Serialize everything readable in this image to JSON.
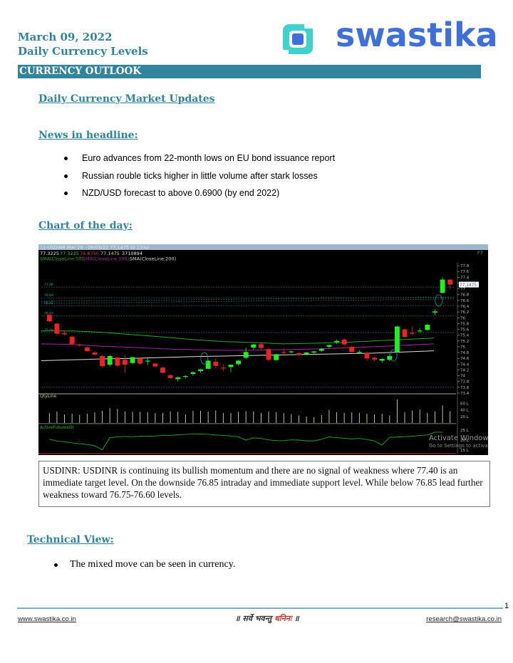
{
  "header": {
    "date": "March 09, 2022",
    "subtitle": "Daily Currency Levels",
    "logo_text": "swastika",
    "section_bar": "CURRENCY OUTLOOK"
  },
  "main": {
    "title": "Daily Currency Market Updates",
    "news_heading": "News in headline:",
    "news": [
      "Euro advances from 22-month lows on EU bond issuance report",
      "Russian rouble ticks higher in little volume after stark losses",
      "NZD/USD forecast to above 0.6900 (by end 2022)"
    ],
    "chart_heading": "Chart of the day:",
    "commentary": "USDINR: USDINR is continuing its bullish momentum and there are no signal of weakness where 77.40 is an immediate target level. On the downside 76.85 intraday and immediate support level. While below 76.85 lead further weakness toward 76.75-76.60 levels.",
    "technical_heading": "Technical View:",
    "technical_points": [
      "The mixed move can be seen in currency."
    ]
  },
  "chart_data": {
    "type": "candlestick",
    "title": "11-USDINR Mar 29 - 08/03/22 77.1475 (0.13%)",
    "ohlc_readout": {
      "open": "77.3225",
      "high": "77.3225",
      "low": "76.8750",
      "close": "77.1475",
      "volume": "3710894"
    },
    "indicator_legend": [
      "SMA(CloseLine:50),",
      "SMA(CloseLine:100),",
      "SMA(CloseLine:200)"
    ],
    "indicator_colors": [
      "#22aa22",
      "#aa22aa",
      "#dddddd"
    ],
    "corner_tag": "F7",
    "last_price_tag": "77.1475",
    "price_axis": {
      "ylim": [
        73.4,
        77.9
      ],
      "ticks": [
        "77.8",
        "77.6",
        "77.4",
        "77.2",
        "77",
        "76.8",
        "76.6",
        "76.4",
        "76.2",
        "76",
        "75.8",
        "75.6",
        "75.4",
        "75.2",
        "75",
        "74.8",
        "74.6",
        "74.4",
        "74.2",
        "74",
        "73.8",
        "73.6",
        "73.4"
      ]
    },
    "level_labels": [
      "77.06",
      "76.69",
      "76.42",
      "76.07",
      "75.49"
    ],
    "candles": [
      {
        "o": 76.1,
        "h": 76.12,
        "l": 75.85,
        "c": 75.88
      },
      {
        "o": 75.8,
        "h": 75.82,
        "l": 75.4,
        "c": 75.45
      },
      {
        "o": 75.47,
        "h": 75.55,
        "l": 75.4,
        "c": 75.43
      },
      {
        "o": 75.35,
        "h": 75.38,
        "l": 75.05,
        "c": 75.1
      },
      {
        "o": 75.08,
        "h": 75.1,
        "l": 75.0,
        "c": 75.05
      },
      {
        "o": 74.98,
        "h": 75.0,
        "l": 74.82,
        "c": 74.85
      },
      {
        "o": 74.8,
        "h": 74.85,
        "l": 74.7,
        "c": 74.73
      },
      {
        "o": 74.68,
        "h": 74.72,
        "l": 74.3,
        "c": 74.33
      },
      {
        "o": 74.38,
        "h": 74.72,
        "l": 74.32,
        "c": 74.68
      },
      {
        "o": 74.63,
        "h": 74.65,
        "l": 74.3,
        "c": 74.35
      },
      {
        "o": 74.55,
        "h": 74.7,
        "l": 74.1,
        "c": 74.38
      },
      {
        "o": 74.44,
        "h": 74.66,
        "l": 74.4,
        "c": 74.64
      },
      {
        "o": 74.6,
        "h": 74.62,
        "l": 74.38,
        "c": 74.42
      },
      {
        "o": 74.52,
        "h": 74.6,
        "l": 74.36,
        "c": 74.52
      },
      {
        "o": 74.42,
        "h": 74.45,
        "l": 74.3,
        "c": 74.32
      },
      {
        "o": 74.28,
        "h": 74.3,
        "l": 74.08,
        "c": 74.1
      },
      {
        "o": 74.02,
        "h": 74.05,
        "l": 73.88,
        "c": 73.92
      },
      {
        "o": 73.88,
        "h": 73.98,
        "l": 73.8,
        "c": 73.94
      },
      {
        "o": 73.96,
        "h": 74.02,
        "l": 73.9,
        "c": 73.99
      },
      {
        "o": 74.06,
        "h": 74.14,
        "l": 74.0,
        "c": 74.12
      },
      {
        "o": 74.16,
        "h": 74.24,
        "l": 74.1,
        "c": 74.22
      },
      {
        "o": 74.24,
        "h": 74.55,
        "l": 74.22,
        "c": 74.52
      },
      {
        "o": 74.48,
        "h": 74.6,
        "l": 74.26,
        "c": 74.34
      },
      {
        "o": 74.28,
        "h": 74.4,
        "l": 74.16,
        "c": 74.26
      },
      {
        "o": 74.3,
        "h": 74.38,
        "l": 74.12,
        "c": 74.38
      },
      {
        "o": 74.4,
        "h": 74.55,
        "l": 74.36,
        "c": 74.52
      },
      {
        "o": 74.62,
        "h": 74.98,
        "l": 74.58,
        "c": 74.82
      },
      {
        "o": 74.97,
        "h": 75.1,
        "l": 74.9,
        "c": 75.08
      },
      {
        "o": 75.09,
        "h": 75.12,
        "l": 74.88,
        "c": 74.96
      },
      {
        "o": 74.92,
        "h": 74.96,
        "l": 74.5,
        "c": 74.55
      },
      {
        "o": 74.54,
        "h": 74.76,
        "l": 74.52,
        "c": 74.74
      },
      {
        "o": 74.82,
        "h": 74.92,
        "l": 74.72,
        "c": 74.8
      },
      {
        "o": 74.82,
        "h": 74.88,
        "l": 74.76,
        "c": 74.84
      },
      {
        "o": 74.78,
        "h": 74.8,
        "l": 74.68,
        "c": 74.72
      },
      {
        "o": 74.74,
        "h": 74.82,
        "l": 74.7,
        "c": 74.8
      },
      {
        "o": 74.8,
        "h": 74.86,
        "l": 74.74,
        "c": 74.84
      },
      {
        "o": 74.86,
        "h": 74.96,
        "l": 74.84,
        "c": 74.93
      },
      {
        "o": 75.0,
        "h": 75.08,
        "l": 74.95,
        "c": 75.06
      },
      {
        "o": 75.16,
        "h": 75.25,
        "l": 75.1,
        "c": 75.2
      },
      {
        "o": 75.25,
        "h": 75.3,
        "l": 75.04,
        "c": 75.08
      },
      {
        "o": 75.0,
        "h": 75.04,
        "l": 74.8,
        "c": 74.82
      },
      {
        "o": 74.8,
        "h": 74.88,
        "l": 74.75,
        "c": 74.82
      },
      {
        "o": 74.78,
        "h": 74.84,
        "l": 74.52,
        "c": 74.6
      },
      {
        "o": 74.62,
        "h": 74.68,
        "l": 74.5,
        "c": 74.56
      },
      {
        "o": 74.52,
        "h": 74.6,
        "l": 74.45,
        "c": 74.58
      },
      {
        "o": 74.55,
        "h": 74.72,
        "l": 74.5,
        "c": 74.68
      },
      {
        "o": 74.82,
        "h": 75.72,
        "l": 74.8,
        "c": 75.7
      },
      {
        "o": 75.6,
        "h": 75.62,
        "l": 75.3,
        "c": 75.34
      },
      {
        "o": 75.48,
        "h": 75.7,
        "l": 75.4,
        "c": 75.45
      },
      {
        "o": 75.55,
        "h": 75.65,
        "l": 75.48,
        "c": 75.56
      },
      {
        "o": 75.58,
        "h": 75.8,
        "l": 75.55,
        "c": 75.76
      },
      {
        "o": 76.18,
        "h": 76.3,
        "l": 76.1,
        "c": 76.22
      },
      {
        "o": 76.86,
        "h": 77.4,
        "l": 76.84,
        "c": 77.32
      },
      {
        "o": 77.32,
        "h": 77.33,
        "l": 77.0,
        "c": 77.15
      }
    ],
    "sma": {
      "sma50": [
        75.55,
        75.55,
        75.5,
        75.42,
        75.34,
        75.25,
        75.18,
        75.15,
        75.1,
        75.12,
        75.15,
        75.2,
        75.25,
        75.3
      ],
      "sma100": [
        75.1,
        75.08,
        75.02,
        74.98,
        74.93,
        74.9,
        74.88,
        74.88,
        74.9,
        74.92,
        74.96,
        75.0,
        75.05,
        75.1
      ],
      "sma200": [
        74.52,
        74.55,
        74.58,
        74.6,
        74.63,
        74.66,
        74.68,
        74.7,
        74.72,
        74.74,
        74.76,
        74.78,
        74.82,
        74.86
      ]
    },
    "qty_panel": {
      "label": "QtyLine",
      "ticks": [
        "60 L",
        "40 L",
        "20 L"
      ],
      "values": [
        30,
        35,
        26,
        28,
        25,
        28,
        32,
        37,
        45,
        43,
        35,
        34,
        34,
        33,
        30,
        31,
        35,
        34,
        26,
        37,
        37,
        35,
        38,
        31,
        30,
        34,
        36,
        35,
        31,
        35,
        33,
        30,
        27,
        23,
        20,
        18,
        24,
        40,
        33,
        31,
        32,
        31,
        28,
        26,
        28,
        23,
        72,
        33,
        38,
        41,
        31,
        35,
        53,
        36
      ]
    },
    "oi_panel": {
      "label": "ActiveFuturesOI",
      "ticks": [
        "25 L",
        "20 L",
        "15 L"
      ],
      "values": [
        20.5,
        19.5,
        19.2,
        18.6,
        18.2,
        17.8,
        17.2,
        15.2,
        21.2,
        21.6,
        21.8,
        21.7,
        21.9,
        21.9,
        22.0,
        22.4,
        22.3,
        22.6,
        22.8,
        23.1,
        23.0,
        22.9,
        22.5,
        22.3,
        22.0,
        21.6,
        20.0,
        21.1,
        20.8,
        20.1,
        19.7,
        19.7,
        20.1,
        20.0,
        19.6,
        19.6,
        20.4,
        21.6,
        21.2,
        20.9,
        20.6,
        20.8,
        20.3,
        19.6,
        17.6,
        21.4,
        21.5,
        21.7,
        21.9,
        22.3,
        22.5,
        23.9,
        23.9
      ]
    },
    "watermark": [
      "Activate Windows",
      "Go to Settings to activate"
    ]
  },
  "footer": {
    "website": "www.swastika.co.in",
    "motto_a": "॥ सर्वे भवन्तु",
    "motto_b": "धनिनः",
    "motto_c": "॥",
    "email": "research@swastika.co.in",
    "page_number": "1"
  }
}
